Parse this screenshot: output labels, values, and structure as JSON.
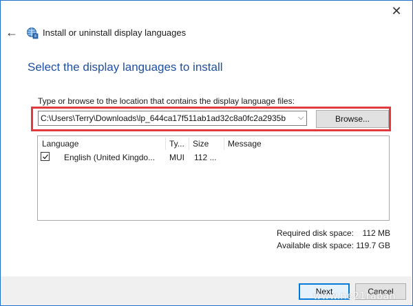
{
  "window": {
    "title": "Install or uninstall display languages",
    "close_glyph": "✕",
    "back_glyph": "←",
    "frame_color": "#1e6fc9"
  },
  "page": {
    "heading": "Select the display languages to install",
    "heading_color": "#1e4fa3",
    "instruction": "Type or browse to the location that contains the display language files:"
  },
  "path": {
    "value": "C:\\Users\\Terry\\Downloads\\lp_644ca17f511ab1ad32c8a0fc2a2935b",
    "arrow_glyph": "⌵"
  },
  "browse": {
    "label": "Browse..."
  },
  "highlight_color": "#e0393e",
  "list": {
    "columns": [
      "Language",
      "Ty...",
      "Size",
      "Message"
    ],
    "rows": [
      {
        "checked": true,
        "language": "English (United Kingdo...",
        "type": "MUI",
        "size": "112 ...",
        "message": ""
      }
    ]
  },
  "disk": {
    "required_label": "Required disk space:",
    "required_value": "112 MB",
    "available_label": "Available disk space:",
    "available_value": "119.7 GB"
  },
  "footer": {
    "next_label": "Next",
    "cancel_label": "Cancel",
    "accent_color": "#0078d7"
  },
  "watermark": "www.ne21raban"
}
